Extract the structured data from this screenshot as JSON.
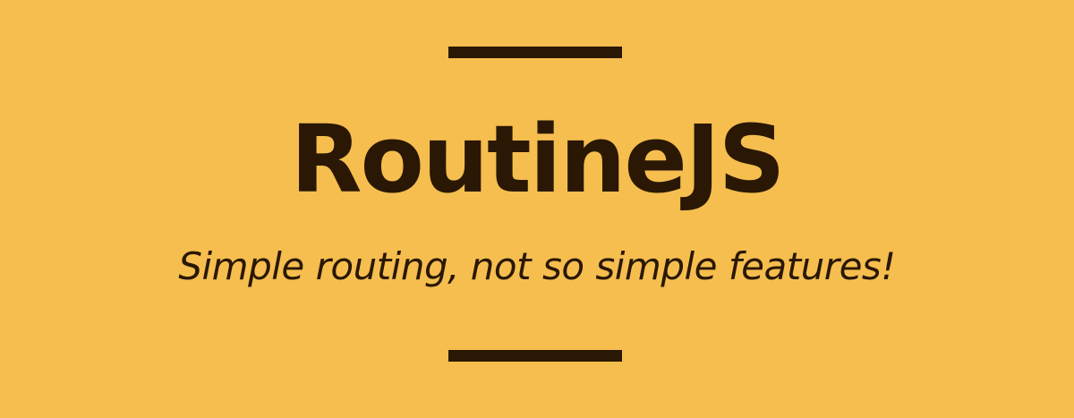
{
  "banner": {
    "title": "RoutineJS",
    "tagline": "Simple routing, not so simple features!"
  },
  "colors": {
    "background": "#f6be4f",
    "foreground": "#2a1804"
  }
}
